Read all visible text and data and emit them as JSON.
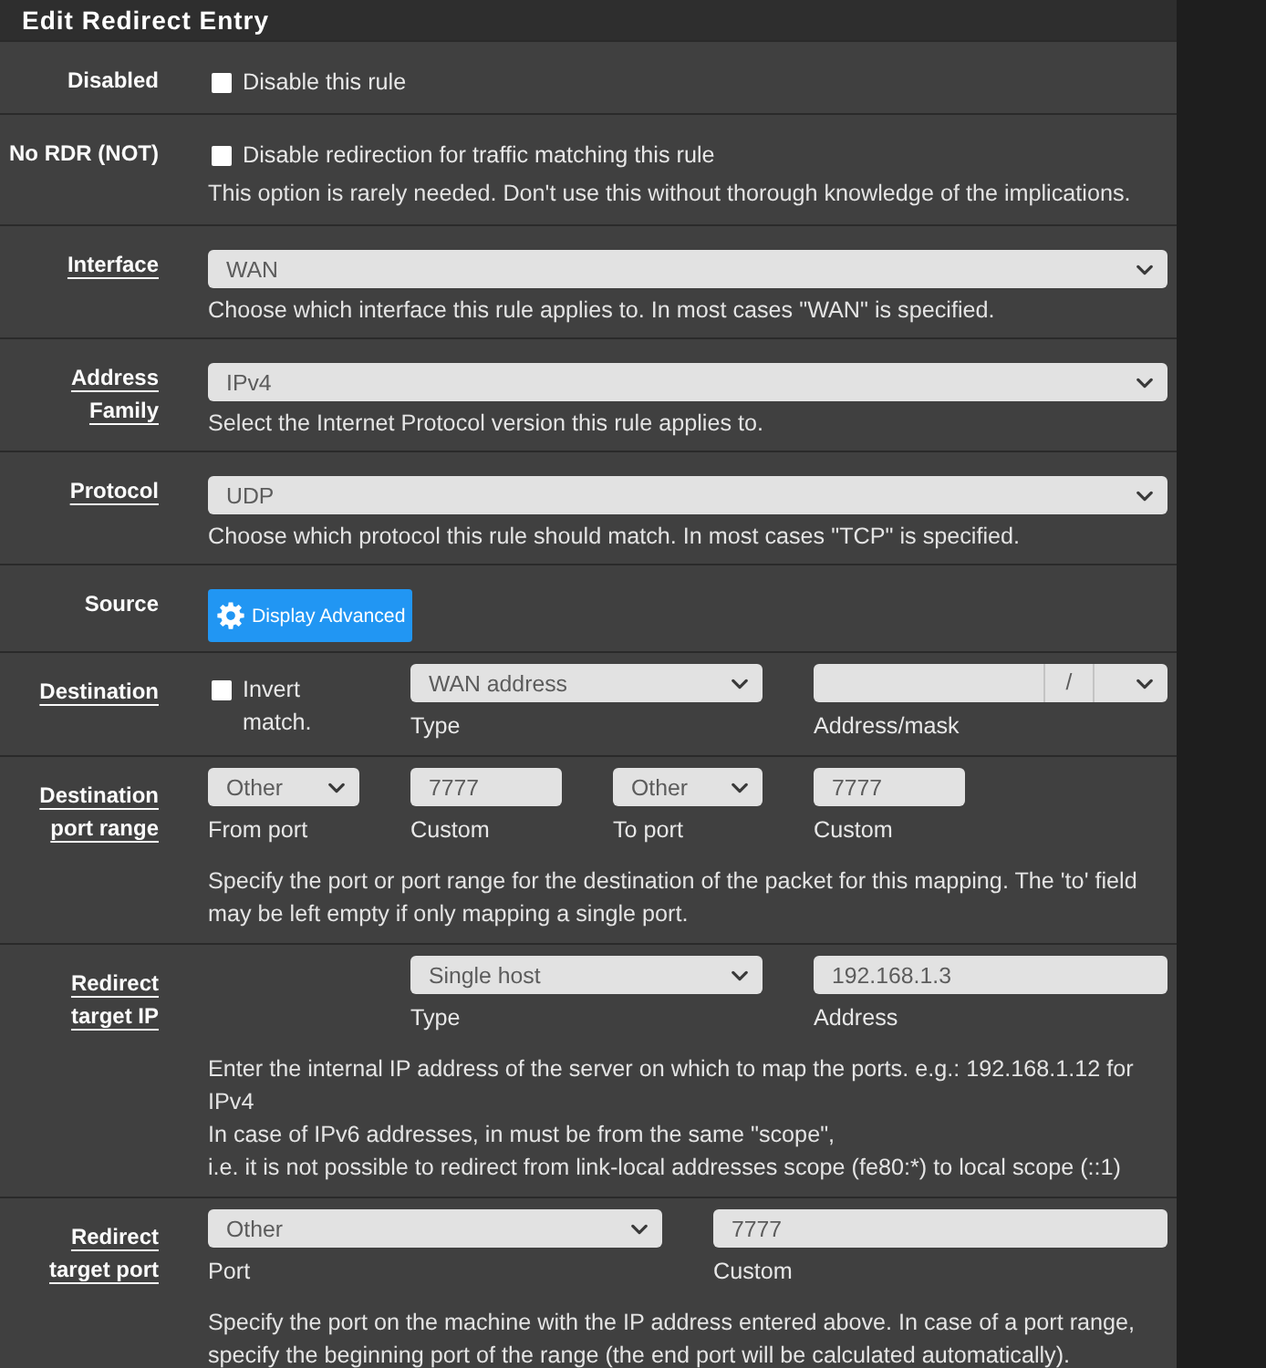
{
  "panel": {
    "title": "Edit Redirect Entry"
  },
  "rows": [
    {
      "label": "Disabled",
      "required": false,
      "kind": "checkbox",
      "checkbox": {
        "label": "Disable this rule",
        "checked": false
      }
    },
    {
      "label": "No RDR (NOT)",
      "required": false,
      "kind": "checkbox",
      "checkbox": {
        "label": "Disable redirection for traffic matching this rule",
        "checked": false
      },
      "help": [
        "This option is rarely needed. Don't use this without thorough knowledge of the implications."
      ]
    },
    {
      "label": "Interface",
      "required": true,
      "kind": "select",
      "select": {
        "value": "WAN"
      },
      "help": [
        "Choose which interface this rule applies to. In most cases \"WAN\" is specified."
      ]
    },
    {
      "label": "Address Family",
      "required": true,
      "kind": "select",
      "select": {
        "value": "IPv4"
      },
      "help": [
        "Select the Internet Protocol version this rule applies to."
      ]
    },
    {
      "label": "Protocol",
      "required": true,
      "kind": "select",
      "select": {
        "value": "UDP"
      },
      "help": [
        "Choose which protocol this rule should match. In most cases \"TCP\" is specified."
      ]
    },
    {
      "label": "Source",
      "required": false,
      "kind": "button",
      "button": {
        "label": "Display Advanced"
      }
    },
    {
      "label": "Destination",
      "required": true,
      "kind": "destination",
      "invert": {
        "label": "Invert match.",
        "checked": false
      },
      "type": {
        "value": "WAN address",
        "caption": "Type"
      },
      "address": {
        "separator": "/",
        "caption": "Address/mask"
      }
    },
    {
      "label": "Destination port range",
      "required": true,
      "kind": "port_range",
      "fields": [
        {
          "kind": "select",
          "value": "Other",
          "caption": "From port"
        },
        {
          "kind": "input",
          "value": "7777",
          "caption": "Custom"
        },
        {
          "kind": "select",
          "value": "Other",
          "caption": "To port"
        },
        {
          "kind": "input",
          "value": "7777",
          "caption": "Custom"
        }
      ],
      "help": [
        "Specify the port or port range for the destination of the packet for this mapping. The 'to' field may be left empty if only mapping a single port."
      ]
    },
    {
      "label": "Redirect target IP",
      "required": true,
      "kind": "target_ip",
      "fields": [
        {
          "kind": "select",
          "value": "Single host",
          "caption": "Type"
        },
        {
          "kind": "input",
          "value": "192.168.1.3",
          "caption": "Address"
        }
      ],
      "help": [
        "Enter the internal IP address of the server on which to map the ports. e.g.: 192.168.1.12 for IPv4",
        "In case of IPv6 addresses, in must be from the same \"scope\",",
        "i.e. it is not possible to redirect from link-local addresses scope (fe80:*) to local scope (::1)"
      ]
    },
    {
      "label": "Redirect target port",
      "required": true,
      "kind": "target_port",
      "fields": [
        {
          "kind": "select",
          "value": "Other",
          "caption": "Port"
        },
        {
          "kind": "input",
          "value": "7777",
          "caption": "Custom"
        }
      ],
      "help": [
        "Specify the port on the machine with the IP address entered above. In case of a port range, specify the beginning port of the range (the end port will be calculated automatically)."
      ]
    }
  ]
}
